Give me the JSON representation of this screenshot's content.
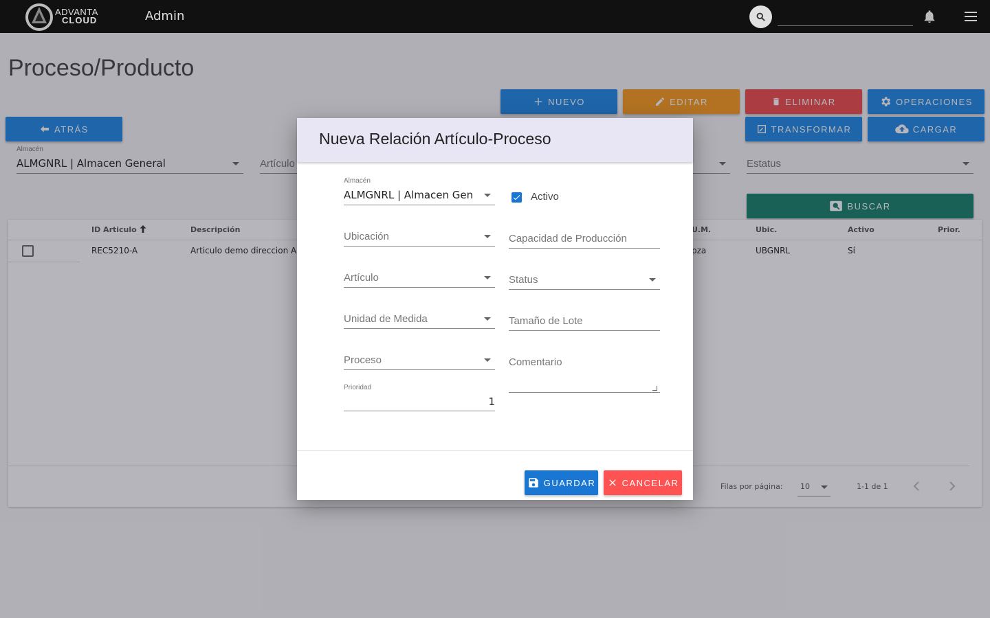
{
  "topbar": {
    "logo_line1": "ADVANTA",
    "logo_line2": "CLOUD",
    "section": "Admin",
    "search_value": ""
  },
  "page": {
    "title": "Proceso/Producto",
    "buttons": {
      "nuevo": "Nuevo",
      "editar": "Editar",
      "eliminar": "Eliminar",
      "operaciones": "Operaciones",
      "atras": "Atrás",
      "transformar": "Transformar",
      "cargar": "Cargar",
      "buscar": "Buscar"
    },
    "filters": {
      "almacen_label": "Almacén",
      "almacen_value": "ALMGNRL | Almacen General",
      "articulo_placeholder": "Artículo",
      "estatus_placeholder": "Estatus"
    },
    "table": {
      "headers": {
        "id": "ID Articulo",
        "descripcion": "Descripción",
        "um": "U.M.",
        "ubic": "Ubic.",
        "activo": "Activo",
        "prior": "Prior."
      },
      "rows": [
        {
          "id": "REC5210-A",
          "descripcion": "Articulo demo direccion A",
          "um": "pza",
          "ubic": "UBGNRL",
          "activo": "Sí",
          "prior": ""
        }
      ],
      "footer": {
        "rows_per_page_label": "Filas por página:",
        "rows_per_page_value": "10",
        "range": "1-1 de 1"
      }
    }
  },
  "dialog": {
    "title": "Nueva Relación Artículo-Proceso",
    "almacen_label": "Almacén",
    "almacen_value": "ALMGNRL | Almacen Gen",
    "activo_label": "Activo",
    "activo_checked": true,
    "ubicacion_placeholder": "Ubicación",
    "capacidad_placeholder": "Capacidad de Producción",
    "articulo_placeholder": "Artículo",
    "status_placeholder": "Status",
    "unidad_placeholder": "Unidad de Medida",
    "tamano_placeholder": "Tamaño de Lote",
    "proceso_placeholder": "Proceso",
    "comentario_placeholder": "Comentario",
    "prioridad_label": "Prioridad",
    "prioridad_value": "1",
    "guardar": "Guardar",
    "cancelar": "Cancelar"
  },
  "colors": {
    "blue": "#1e88e5",
    "orange": "#fb9c1b",
    "red": "#ef4b4b",
    "green": "#17806a",
    "checkbox": "#1976d2"
  }
}
